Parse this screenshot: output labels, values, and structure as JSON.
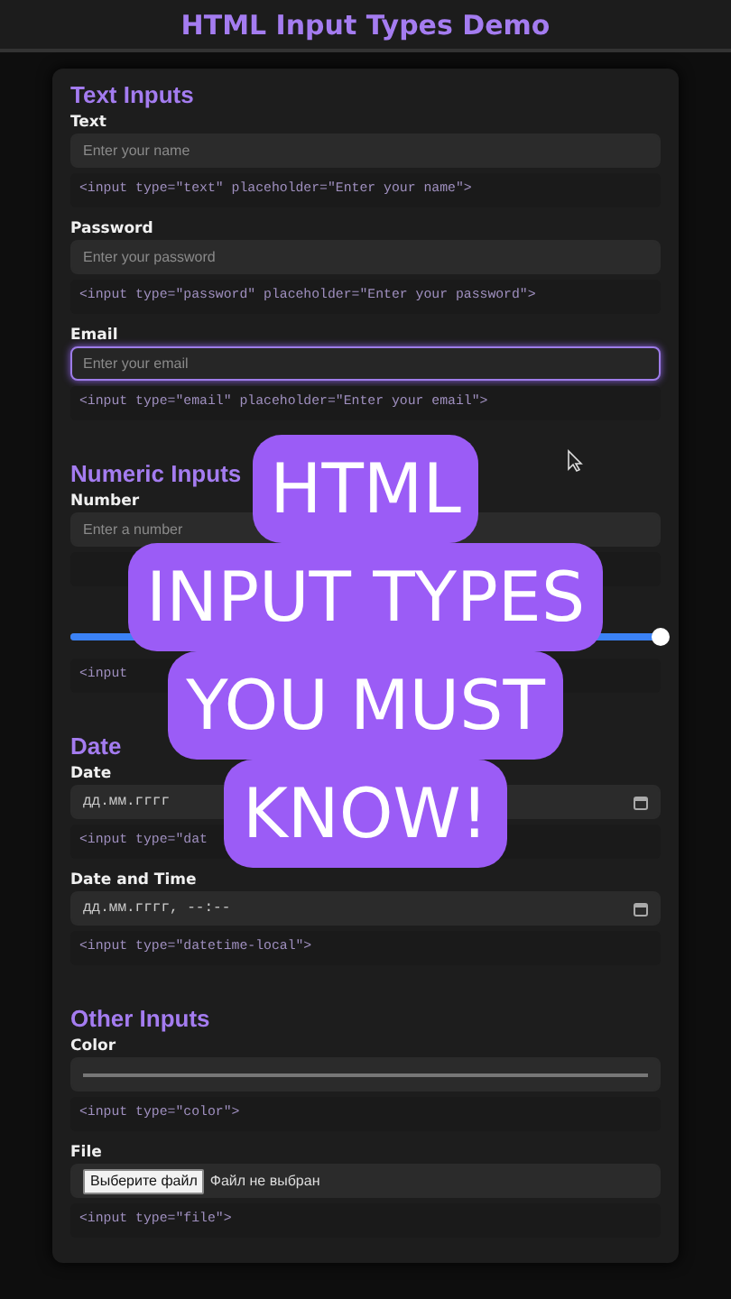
{
  "title": "HTML Input Types Demo",
  "sections": [
    {
      "heading": "Text Inputs",
      "fields": [
        {
          "kind": "text",
          "label": "Text",
          "placeholder": "Enter your name",
          "code": "<input type=\"text\" placeholder=\"Enter your name\">",
          "focused": false
        },
        {
          "kind": "text",
          "label": "Password",
          "placeholder": "Enter your password",
          "code": "<input type=\"password\" placeholder=\"Enter your password\">",
          "focused": false
        },
        {
          "kind": "text",
          "label": "Email",
          "placeholder": "Enter your email",
          "code": "<input type=\"email\" placeholder=\"Enter your email\">",
          "focused": true
        }
      ]
    },
    {
      "heading": "Numeric Inputs",
      "fields": [
        {
          "kind": "text",
          "label": "Number",
          "placeholder": "Enter a number",
          "focused": false
        },
        {
          "kind": "range",
          "level": 1,
          "code": "<input"
        }
      ]
    },
    {
      "heading": "Date",
      "fields": [
        {
          "kind": "date",
          "label": "Date",
          "value": "дд.мм.гггг",
          "code": "<input type=\"dat"
        },
        {
          "kind": "date",
          "label": "Date and Time",
          "value": "дд.мм.гггг, --:--",
          "code": "<input type=\"datetime-local\">"
        }
      ]
    },
    {
      "heading": "Other Inputs",
      "fields": [
        {
          "kind": "color",
          "label": "Color",
          "code": "<input type=\"color\">",
          "focused": false
        },
        {
          "kind": "file",
          "label": "File",
          "button": "Выберите файл",
          "value": "Файл не выбран",
          "code": "<input type=\"file\">"
        }
      ]
    }
  ],
  "overlay": [
    "HTML",
    "INPUT TYPES",
    "YOU MUST",
    "KNOW!"
  ]
}
